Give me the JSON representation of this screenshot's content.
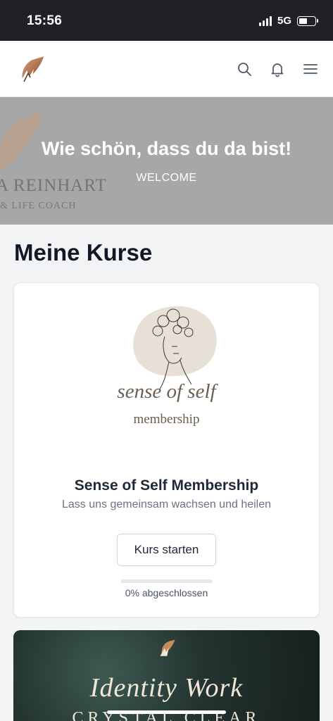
{
  "status_bar": {
    "time": "15:56",
    "network": "5G"
  },
  "header": {
    "icons": [
      "brand-logo",
      "search-icon",
      "bell-icon",
      "menu-icon"
    ]
  },
  "hero": {
    "title": "Wie schön, dass du da bist!",
    "subtitle": "WELCOME",
    "bg_brand": "A REINHART",
    "bg_tagline": "& LIFE COACH"
  },
  "section": {
    "title": "Meine Kurse"
  },
  "courses": [
    {
      "art_script": "sense of self",
      "art_sub": "membership",
      "title": "Sense of Self Membership",
      "description": "Lass uns gemeinsam wachsen und heilen",
      "button_label": "Kurs starten",
      "progress": 0,
      "progress_label": "0% abgeschlossen"
    },
    {
      "art_script": "Identity Work",
      "art_caps": "CRYSTAL CLEAR"
    }
  ],
  "colors": {
    "accent": "#b8734a",
    "hero_bg": "#a7a7a7",
    "text": "#1f2937"
  }
}
